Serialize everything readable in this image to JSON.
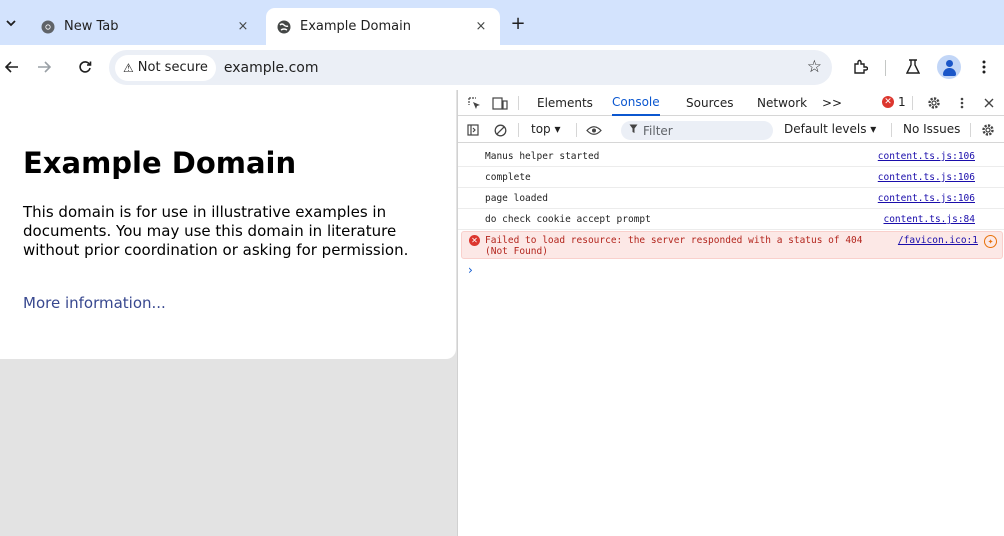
{
  "browser": {
    "tabs": [
      {
        "title": "New Tab",
        "active": false
      },
      {
        "title": "Example Domain",
        "active": true
      }
    ],
    "new_tab_symbol": "+",
    "close_symbol": "×",
    "tab_list_symbol": "⌄",
    "toolbar": {
      "security_chip": "Not secure",
      "url": "example.com",
      "icons": [
        "back-icon",
        "forward-icon",
        "reload-icon",
        "bookmark-star-icon",
        "extensions-icon",
        "labs-flask-icon",
        "profile-avatar-icon",
        "kebab-menu-icon"
      ]
    }
  },
  "page": {
    "heading": "Example Domain",
    "paragraph": "This domain is for use in illustrative examples in documents. You may use this domain in literature without prior coordination or asking for permission.",
    "link": "More information..."
  },
  "devtools": {
    "tabs": [
      "Elements",
      "Console",
      "Sources",
      "Network"
    ],
    "active_tab": "Console",
    "more_tabs_symbol": ">>",
    "error_count": "1",
    "console_bar": {
      "context": "top ▾",
      "filter_placeholder": "Filter",
      "levels": "Default levels ▾",
      "issues": "No Issues"
    },
    "messages": [
      {
        "text": "Manus helper started",
        "source": "content.ts.js:106",
        "level": "log"
      },
      {
        "text": "complete",
        "source": "content.ts.js:106",
        "level": "log"
      },
      {
        "text": "page loaded",
        "source": "content.ts.js:106",
        "level": "log"
      },
      {
        "text": "do check cookie accept prompt",
        "source": "content.ts.js:84",
        "level": "log"
      },
      {
        "text": "Failed to load resource: the server responded with a status of 404 (Not Found)",
        "source": "/favicon.ico:1",
        "level": "error"
      }
    ],
    "prompt_symbol": "›"
  },
  "colors": {
    "tabstrip_bg": "#d3e3fd",
    "accent": "#0b57d0",
    "error": "#dc362e",
    "error_bg": "#fce8e6",
    "link": "#38488f"
  }
}
